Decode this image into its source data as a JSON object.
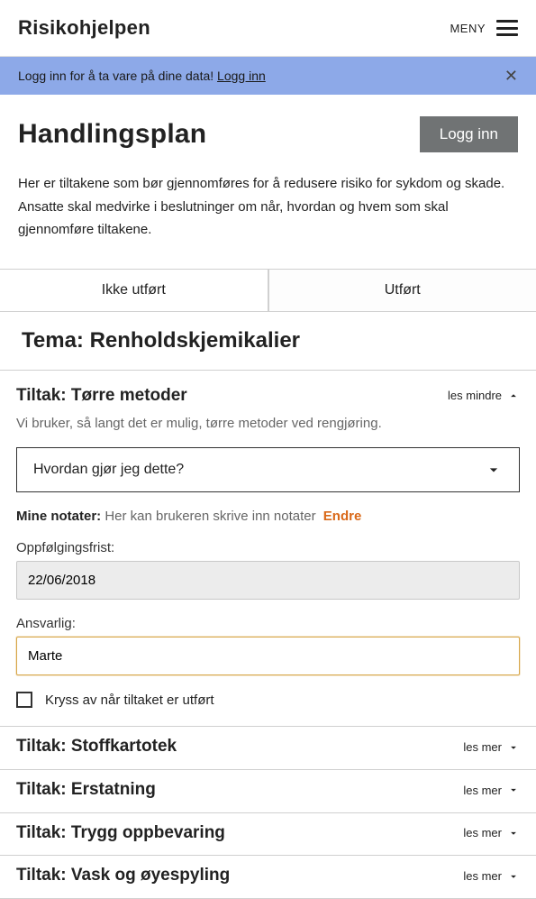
{
  "header": {
    "logo": "Risikohjelpen",
    "menu_label": "MENY"
  },
  "notice": {
    "text": "Logg inn for å ta vare på dine data! ",
    "link": "Logg inn"
  },
  "page": {
    "title": "Handlingsplan",
    "login_button": "Logg inn",
    "intro": "Her er tiltakene som bør gjennomføres for å redusere risiko for sykdom og skade. Ansatte skal medvirke i beslutninger om når, hvordan og hvem som skal gjennomføre tiltakene."
  },
  "tabs": {
    "not_done": "Ikke utført",
    "done": "Utført"
  },
  "tema": {
    "prefix": "Tema: ",
    "name": "Renholdskjemikalier"
  },
  "tiltak_expanded": {
    "title_prefix": "Tiltak: ",
    "title": "Tørre metoder",
    "toggle": "les mindre",
    "desc": "Vi bruker, så langt det er mulig, tørre metoder ved rengjøring.",
    "how_label": "Hvordan gjør jeg dette?",
    "notes_label": "Mine notater:",
    "notes_placeholder": "Her kan brukeren skrive inn notater",
    "endre": "Endre",
    "deadline_label": "Oppfølgingsfrist:",
    "deadline_value": "22/06/2018",
    "responsible_label": "Ansvarlig:",
    "responsible_value": "Marte",
    "check_label": "Kryss av når tiltaket er utført"
  },
  "tiltak_collapsed": [
    {
      "title": "Stoffkartotek",
      "toggle": "les mer"
    },
    {
      "title": "Erstatning",
      "toggle": "les mer"
    },
    {
      "title": "Trygg oppbevaring",
      "toggle": "les mer"
    },
    {
      "title": "Vask og øyespyling",
      "toggle": "les mer"
    }
  ],
  "tiltak_prefix": "Tiltak: "
}
